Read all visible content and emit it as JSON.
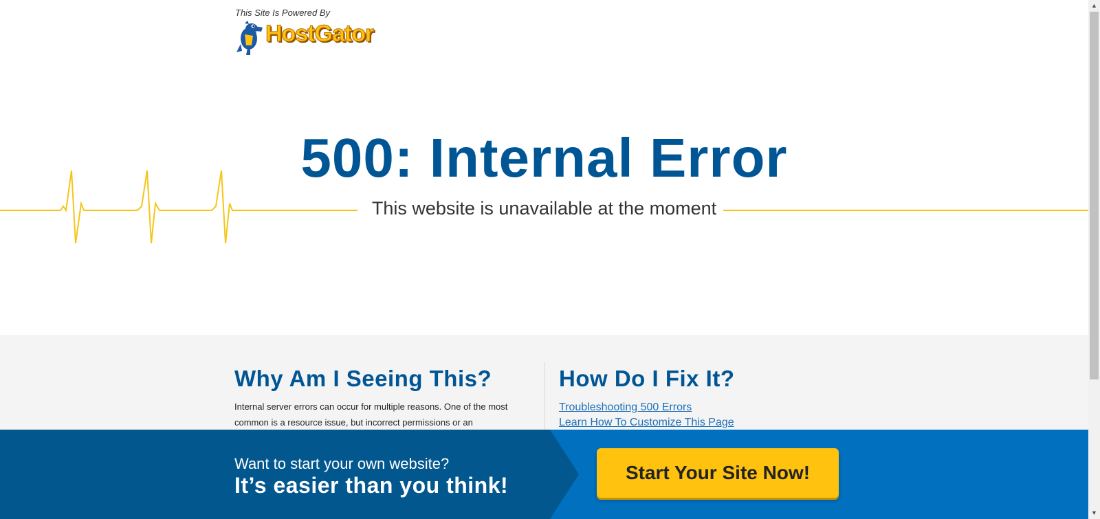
{
  "header": {
    "powered_by": "This Site Is Powered By",
    "brand": "HostGator"
  },
  "hero": {
    "title": "500: Internal Error",
    "subtitle": "This website is unavailable at the moment"
  },
  "why": {
    "title": "Why Am I Seeing This?",
    "text": "Internal server errors can occur for multiple reasons. One of the most common is a resource issue, but incorrect permissions or an"
  },
  "fix": {
    "title": "How Do I Fix It?",
    "links": [
      "Troubleshooting 500 Errors",
      "Learn How To Customize This Page"
    ]
  },
  "banner": {
    "small": "Want to start your own website?",
    "big": "It’s easier than you think!",
    "cta": "Start Your Site Now!"
  },
  "colors": {
    "brand_blue": "#005595",
    "banner_dark": "#02578f",
    "banner_light": "#0070bf",
    "accent_yellow": "#ffc20e"
  },
  "icons": [
    "hostgator-logo-icon",
    "heartbeat-line-icon",
    "scroll-up-icon",
    "scroll-down-icon"
  ]
}
